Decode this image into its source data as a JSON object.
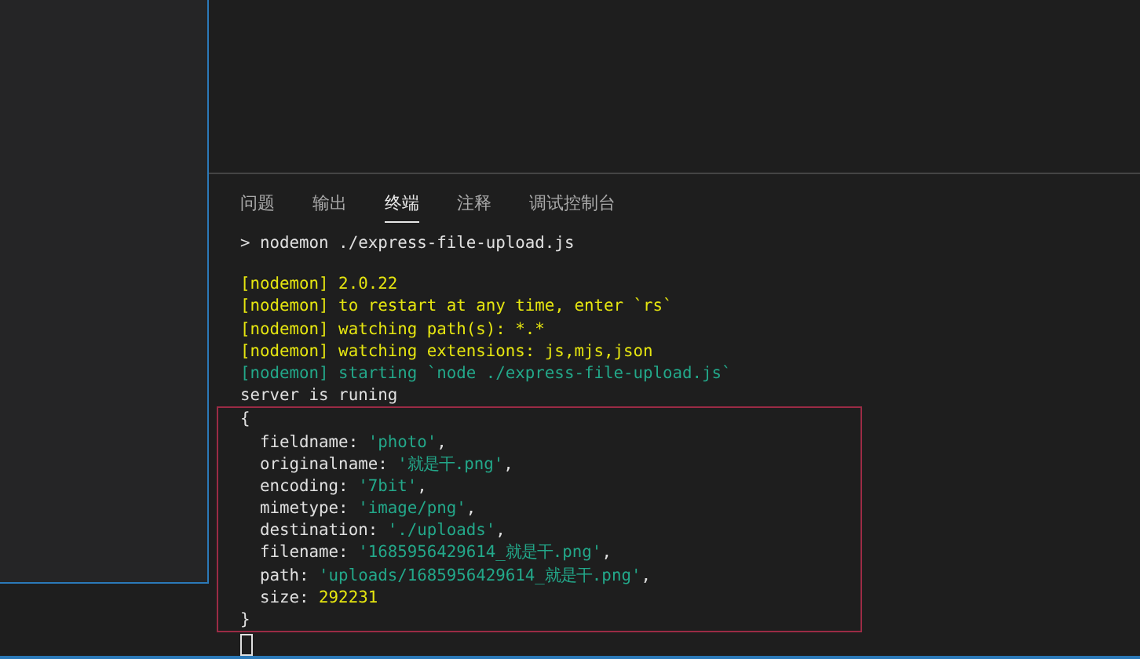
{
  "panel": {
    "tabs": [
      {
        "label": "问题",
        "selected": false
      },
      {
        "label": "输出",
        "selected": false
      },
      {
        "label": "终端",
        "selected": true
      },
      {
        "label": "注释",
        "selected": false
      },
      {
        "label": "调试控制台",
        "selected": false
      }
    ]
  },
  "terminal": {
    "command": [
      {
        "text": "> nodemon ./express-file-upload.js",
        "color": "#e0e0e0"
      }
    ],
    "lines": [
      [
        {
          "text": "[nodemon] 2.0.22",
          "color": "#e5e510"
        }
      ],
      [
        {
          "text": "[nodemon] to restart at any time, enter `rs`",
          "color": "#e5e510"
        }
      ],
      [
        {
          "text": "[nodemon] watching path(s): *.*",
          "color": "#e5e510"
        }
      ],
      [
        {
          "text": "[nodemon] watching extensions: js,mjs,json",
          "color": "#e5e510"
        }
      ],
      [
        {
          "text": "[nodemon] starting `node ./express-file-upload.js`",
          "color": "#23a88a"
        }
      ],
      [
        {
          "text": "server is runing",
          "color": "#e0e0e0"
        }
      ]
    ],
    "highlighted_lines": [
      [
        {
          "text": "{",
          "color": "#e0e0e0"
        }
      ],
      [
        {
          "text": "  fieldname: ",
          "color": "#e0e0e0"
        },
        {
          "text": "'photo'",
          "color": "#23a88a"
        },
        {
          "text": ",",
          "color": "#e0e0e0"
        }
      ],
      [
        {
          "text": "  originalname: ",
          "color": "#e0e0e0"
        },
        {
          "text": "'就是干.png'",
          "color": "#23a88a"
        },
        {
          "text": ",",
          "color": "#e0e0e0"
        }
      ],
      [
        {
          "text": "  encoding: ",
          "color": "#e0e0e0"
        },
        {
          "text": "'7bit'",
          "color": "#23a88a"
        },
        {
          "text": ",",
          "color": "#e0e0e0"
        }
      ],
      [
        {
          "text": "  mimetype: ",
          "color": "#e0e0e0"
        },
        {
          "text": "'image/png'",
          "color": "#23a88a"
        },
        {
          "text": ",",
          "color": "#e0e0e0"
        }
      ],
      [
        {
          "text": "  destination: ",
          "color": "#e0e0e0"
        },
        {
          "text": "'./uploads'",
          "color": "#23a88a"
        },
        {
          "text": ",",
          "color": "#e0e0e0"
        }
      ],
      [
        {
          "text": "  filename: ",
          "color": "#e0e0e0"
        },
        {
          "text": "'1685956429614_就是干.png'",
          "color": "#23a88a"
        },
        {
          "text": ",",
          "color": "#e0e0e0"
        }
      ],
      [
        {
          "text": "  path: ",
          "color": "#e0e0e0"
        },
        {
          "text": "'uploads/1685956429614_就是干.png'",
          "color": "#23a88a"
        },
        {
          "text": ",",
          "color": "#e0e0e0"
        }
      ],
      [
        {
          "text": "  size: ",
          "color": "#e0e0e0"
        },
        {
          "text": "292231",
          "color": "#e5e510"
        }
      ],
      [
        {
          "text": "}",
          "color": "#e0e0e0"
        }
      ]
    ]
  }
}
